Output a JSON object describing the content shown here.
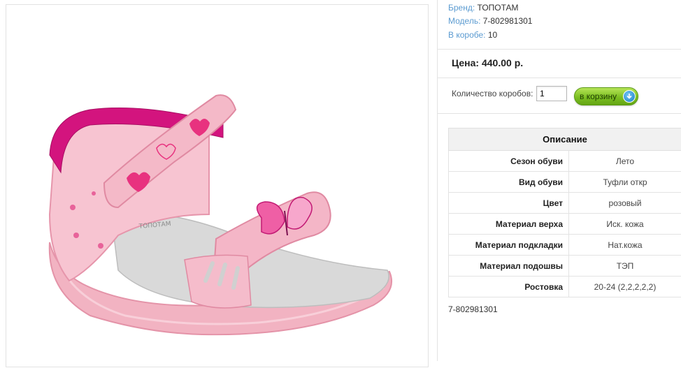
{
  "product": {
    "image_alt": "Сандалии розовые",
    "meta": [
      {
        "label": "Бренд:",
        "value": "ТОПОТАМ"
      },
      {
        "label": "Модель:",
        "value": "7-802981301"
      },
      {
        "label": "В коробе:",
        "value": "10"
      }
    ],
    "price": "Цена: 440.00 р.",
    "quantity": {
      "label": "Количество коробов:",
      "value": "1"
    },
    "cart_button": "в корзину",
    "description": {
      "title": "Описание",
      "rows": [
        {
          "key": "Сезон обуви",
          "value": "Лето"
        },
        {
          "key": "Вид обуви",
          "value": "Туфли откр"
        },
        {
          "key": "Цвет",
          "value": "розовый"
        },
        {
          "key": "Материал верха",
          "value": "Иск. кожа"
        },
        {
          "key": "Материал подкладки",
          "value": "Нат.кожа"
        },
        {
          "key": "Материал подошвы",
          "value": "ТЭП"
        },
        {
          "key": "Ростовка",
          "value": "20-24 (2,2,2,2,2)"
        }
      ]
    },
    "article": "7-802981301"
  },
  "icons": {
    "cart": "cart-arrow-icon"
  },
  "colors": {
    "accent_link": "#5b9bd1",
    "button_green": "#7cbf22",
    "sandal_pink": "#f2b6c4",
    "strap_magenta": "#d3147e"
  }
}
